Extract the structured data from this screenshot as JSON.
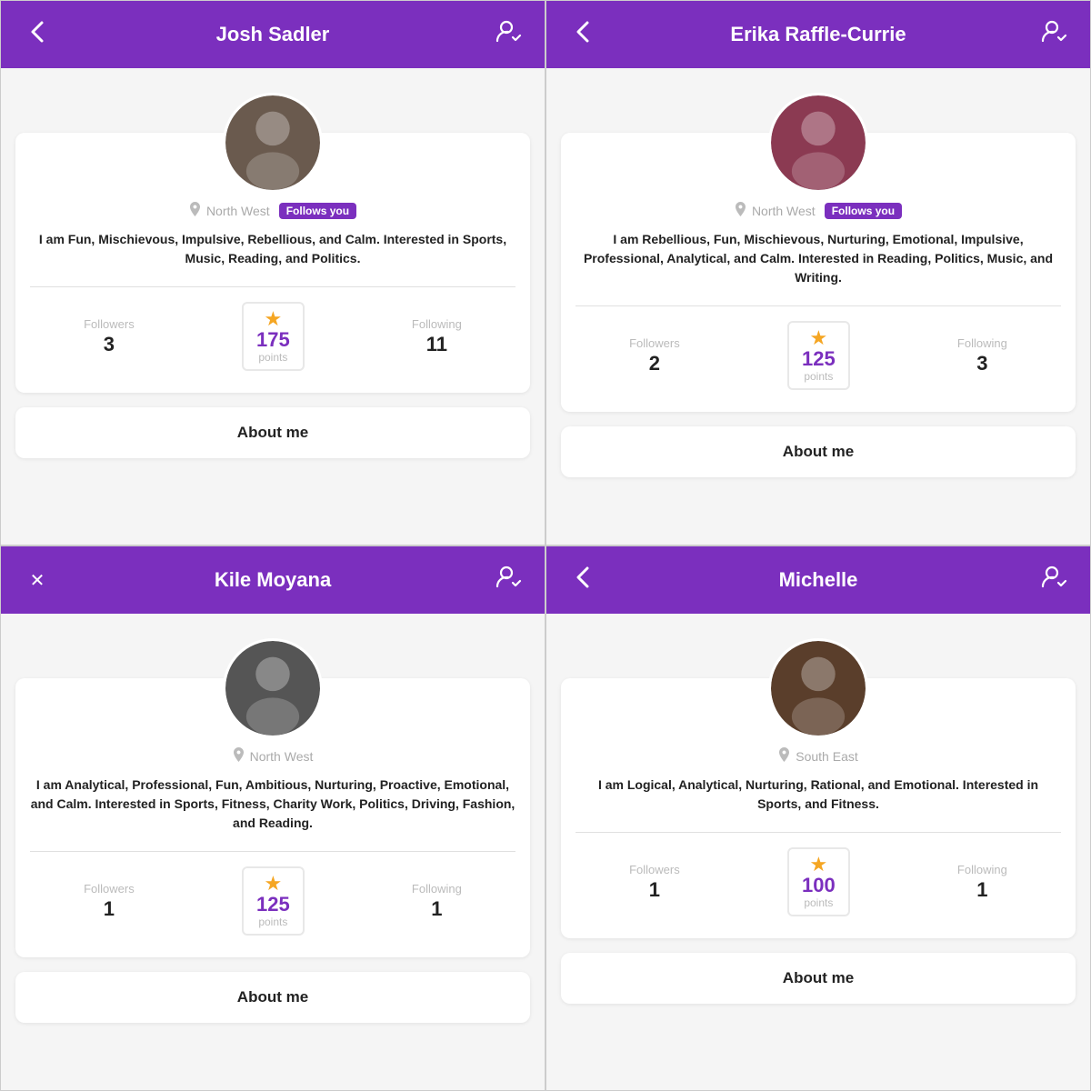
{
  "panels": [
    {
      "id": "josh",
      "header": {
        "back_icon": "‹",
        "title": "Josh Sadler",
        "profile_icon": "⊹",
        "back_type": "back"
      },
      "location": "North West",
      "follows_you": true,
      "bio": "I am Fun, Mischievous, Impulsive, Rebellious, and Calm. Interested in Sports, Music, Reading, and Politics.",
      "followers": 3,
      "points": 175,
      "following": 11,
      "avatar_color": "#6a5a4e",
      "avatar_label": "Josh",
      "about_me_title": "About me"
    },
    {
      "id": "erika",
      "header": {
        "back_icon": "‹",
        "title": "Erika Raffle-Currie",
        "profile_icon": "⊹",
        "back_type": "back"
      },
      "location": "North West",
      "follows_you": true,
      "bio": "I am Rebellious, Fun, Mischievous, Nurturing, Emotional, Impulsive, Professional, Analytical, and Calm. Interested in Reading, Politics, Music, and Writing.",
      "followers": 2,
      "points": 125,
      "following": 3,
      "avatar_color": "#8b3a52",
      "avatar_label": "Erika",
      "about_me_title": "About me"
    },
    {
      "id": "kile",
      "header": {
        "back_icon": "✕",
        "title": "Kile Moyana",
        "profile_icon": "⊹",
        "back_type": "close"
      },
      "location": "North West",
      "follows_you": false,
      "bio": "I am Analytical, Professional, Fun, Ambitious, Nurturing, Proactive, Emotional, and Calm. Interested in Sports, Fitness, Charity Work, Politics, Driving, Fashion, and Reading.",
      "followers": 1,
      "points": 125,
      "following": 1,
      "avatar_color": "#555",
      "avatar_label": "Kile",
      "about_me_title": "About me"
    },
    {
      "id": "michelle",
      "header": {
        "back_icon": "‹",
        "title": "Michelle",
        "profile_icon": "⊹",
        "back_type": "back"
      },
      "location": "South East",
      "follows_you": false,
      "bio": "I am Logical, Analytical, Nurturing, Rational, and Emotional. Interested in Sports, and Fitness.",
      "followers": 1,
      "points": 100,
      "following": 1,
      "avatar_color": "#5a3e2b",
      "avatar_label": "Michelle",
      "about_me_title": "About me"
    }
  ],
  "labels": {
    "follows_you": "Follows you",
    "followers": "Followers",
    "following": "Following",
    "points": "points"
  }
}
